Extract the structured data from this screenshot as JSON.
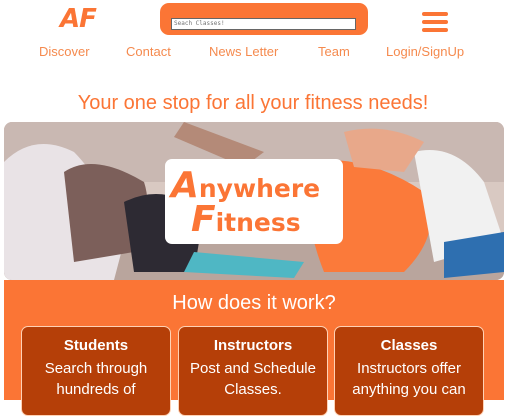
{
  "logo": {
    "text": "AF"
  },
  "search": {
    "placeholder": "Seach Classes!"
  },
  "nav": {
    "items": [
      "Discover",
      "Contact",
      "News Letter",
      "Team",
      "Login/SignUp"
    ]
  },
  "tagline": "Your one stop for all your fitness needs!",
  "hero": {
    "title_cap1": "A",
    "title_rest1": "nywhere",
    "title_cap2": "F",
    "title_rest2": "itness"
  },
  "how": {
    "title": "How does it work?",
    "cards": [
      {
        "title": "Students",
        "desc": "Search through hundreds of"
      },
      {
        "title": "Instructors",
        "desc": "Post and Schedule Classes."
      },
      {
        "title": "Classes",
        "desc": "Instructors offer anything you can"
      }
    ]
  },
  "colors": {
    "accent": "#fb7535",
    "card_bg": "#b53f08"
  }
}
